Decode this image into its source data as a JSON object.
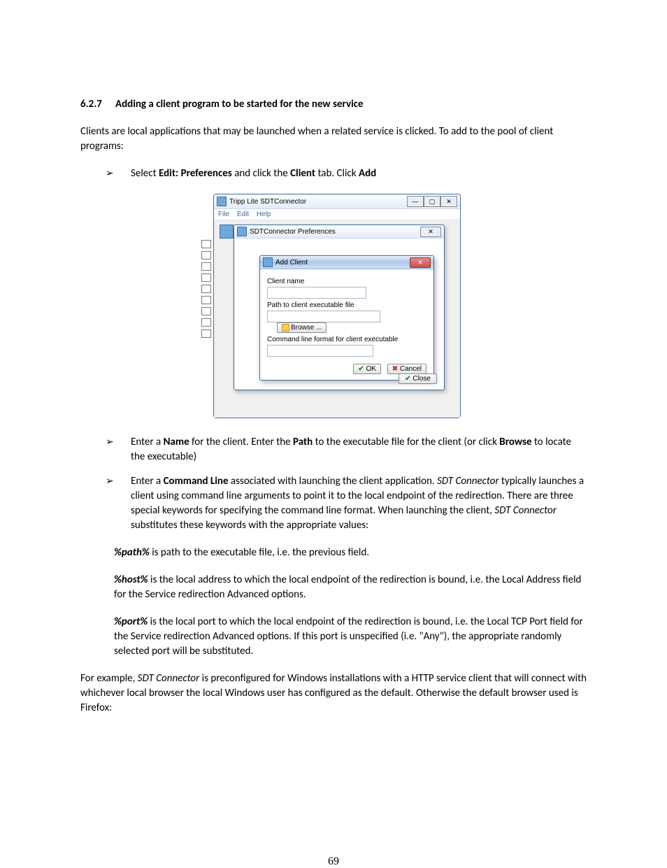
{
  "section": {
    "number": "6.2.7",
    "title": "Adding a client program to be started for the new service"
  },
  "p1": "Clients are local applications that may be launched when a related service is clicked. To add to the pool of client programs:",
  "bullets_a": [
    {
      "pre": "Select ",
      "b1": "Edit: Preferences",
      "mid": " and click the ",
      "b2": "Client",
      "post1": " tab. Click ",
      "b3": "Add"
    }
  ],
  "screenshot": {
    "window_title": "Tripp Lite SDTConnector",
    "menubar": [
      "File",
      "Edit",
      "Help"
    ],
    "win_controls": [
      "—",
      "▢",
      "✕"
    ],
    "prefs": {
      "title": "SDTConnector Preferences",
      "x": "✕",
      "close": "Close"
    },
    "addclient": {
      "title": "Add Client",
      "x": "✕",
      "label_name": "Client name",
      "label_path": "Path to client executable file",
      "browse": "Browse ...",
      "label_cmd": "Command line format for client executable",
      "ok": "OK",
      "cancel": "Cancel"
    }
  },
  "bullets_b": [
    {
      "seg": [
        {
          "t": "Enter a "
        },
        {
          "t": "Name",
          "b": true
        },
        {
          "t": " for the client. Enter the "
        },
        {
          "t": "Path",
          "b": true
        },
        {
          "t": " to the executable file for the client (or click "
        },
        {
          "t": "Browse",
          "b": true
        },
        {
          "t": " to locate the executable)"
        }
      ]
    },
    {
      "seg": [
        {
          "t": "Enter a "
        },
        {
          "t": "Command Line",
          "b": true
        },
        {
          "t": " associated with launching the client application. "
        },
        {
          "t": "SDT Connector",
          "i": true
        },
        {
          "t": " typically launches a client using command line arguments to point it to the local endpoint of the redirection. There are three special keywords for specifying the command line format. When launching the client, "
        },
        {
          "t": "SDT Connector",
          "i": true
        },
        {
          "t": " substitutes these keywords with the appropriate values:"
        }
      ]
    }
  ],
  "kw": [
    {
      "k": "%path%",
      "t": " is path to the executable file, i.e. the previous field."
    },
    {
      "k": "%host%",
      "t": " is the local address to which the local endpoint of the redirection is bound, i.e. the Local Address field for the Service redirection Advanced options."
    },
    {
      "k": "%port%",
      "t": " is the local port to which the local endpoint of the redirection is bound, i.e. the Local TCP Port field for the Service redirection Advanced options. If this port is unspecified (i.e. \"Any\"), the appropriate randomly selected port will be substituted."
    }
  ],
  "p_last": {
    "pre": "For example, ",
    "it": "SDT Connector",
    "post": " is preconfigured for Windows installations with a HTTP service client that will connect with whichever local browser the local Windows user has configured as the default. Otherwise the default browser used is Firefox:"
  },
  "page_number": "69"
}
